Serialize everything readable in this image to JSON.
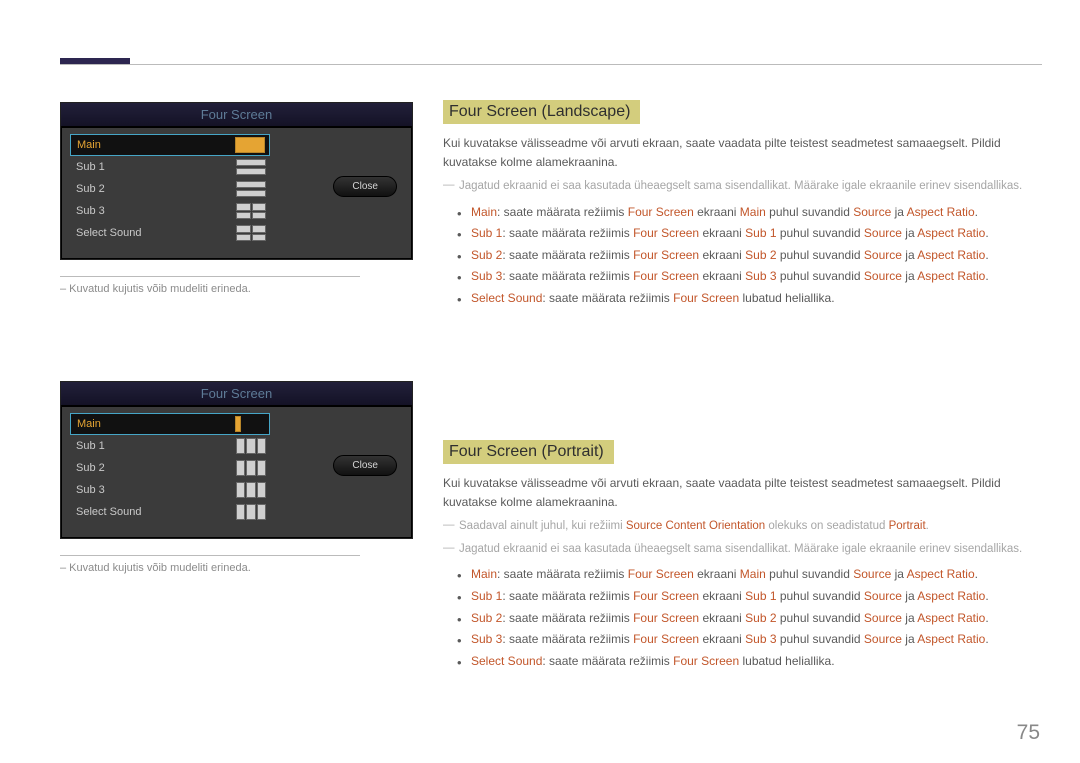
{
  "page_number": "75",
  "caption": "– Kuvatud kujutis võib mudeliti erineda.",
  "osd": {
    "title": "Four Screen",
    "items": [
      "Main",
      "Sub 1",
      "Sub 2",
      "Sub 3",
      "Select Sound"
    ],
    "close": "Close"
  },
  "sections": [
    {
      "heading": "Four Screen (Landscape)",
      "intro": "Kui kuvatakse välisseadme või arvuti ekraan, saate vaadata pilte teistest seadmetest samaaegselt. Pildid kuvatakse kolme alamekraanina.",
      "notes": [
        "Jagatud ekraanid ei saa kasutada üheaegselt sama sisendallikat. Määrake igale ekraanile erinev sisendallikas."
      ],
      "bullets": [
        {
          "kw": "Main",
          "t1": ": saate määrata režiimis ",
          "kw2": "Four Screen",
          "t2": " ekraani ",
          "kw3": "Main",
          "t3": " puhul suvandid ",
          "kw4": "Source",
          "t4": " ja ",
          "kw5": "Aspect Ratio",
          "t5": "."
        },
        {
          "kw": "Sub 1",
          "t1": ": saate määrata režiimis ",
          "kw2": "Four Screen",
          "t2": " ekraani ",
          "kw3": "Sub 1",
          "t3": " puhul suvandid ",
          "kw4": "Source",
          "t4": " ja ",
          "kw5": "Aspect Ratio",
          "t5": "."
        },
        {
          "kw": "Sub 2",
          "t1": ": saate määrata režiimis ",
          "kw2": "Four Screen",
          "t2": " ekraani ",
          "kw3": "Sub 2",
          "t3": " puhul suvandid ",
          "kw4": "Source",
          "t4": " ja ",
          "kw5": "Aspect Ratio",
          "t5": "."
        },
        {
          "kw": "Sub 3",
          "t1": ": saate määrata režiimis ",
          "kw2": "Four Screen",
          "t2": " ekraani ",
          "kw3": "Sub 3",
          "t3": " puhul suvandid ",
          "kw4": "Source",
          "t4": " ja ",
          "kw5": "Aspect Ratio",
          "t5": "."
        },
        {
          "kw": "Select Sound",
          "t1": ": saate määrata režiimis ",
          "kw2": "Four Screen",
          "t2": " lubatud heliallika.",
          "kw3": "",
          "t3": "",
          "kw4": "",
          "t4": "",
          "kw5": "",
          "t5": ""
        }
      ]
    },
    {
      "heading": "Four Screen (Portrait)",
      "intro": "Kui kuvatakse välisseadme või arvuti ekraan, saate vaadata pilte teistest seadmetest samaaegselt. Pildid kuvatakse kolme alamekraanina.",
      "notes": [
        {
          "pre": "Saadaval ainult juhul, kui režiimi ",
          "kw": "Source Content Orientation",
          "mid": " olekuks on seadistatud ",
          "kw2": "Portrait",
          "post": "."
        },
        "Jagatud ekraanid ei saa kasutada üheaegselt sama sisendallikat. Määrake igale ekraanile erinev sisendallikas."
      ],
      "bullets": [
        {
          "kw": "Main",
          "t1": ": saate määrata režiimis ",
          "kw2": "Four Screen",
          "t2": " ekraani ",
          "kw3": "Main",
          "t3": " puhul suvandid ",
          "kw4": "Source",
          "t4": " ja ",
          "kw5": "Aspect Ratio",
          "t5": "."
        },
        {
          "kw": "Sub 1",
          "t1": ": saate määrata režiimis ",
          "kw2": "Four Screen",
          "t2": " ekraani ",
          "kw3": "Sub 1",
          "t3": " puhul suvandid ",
          "kw4": "Source",
          "t4": " ja ",
          "kw5": "Aspect Ratio",
          "t5": "."
        },
        {
          "kw": "Sub 2",
          "t1": ": saate määrata režiimis ",
          "kw2": "Four Screen",
          "t2": " ekraani ",
          "kw3": "Sub 2",
          "t3": " puhul suvandid ",
          "kw4": "Source",
          "t4": " ja ",
          "kw5": "Aspect Ratio",
          "t5": "."
        },
        {
          "kw": "Sub 3",
          "t1": ": saate määrata režiimis ",
          "kw2": "Four Screen",
          "t2": " ekraani ",
          "kw3": "Sub 3",
          "t3": " puhul suvandid ",
          "kw4": "Source",
          "t4": " ja ",
          "kw5": "Aspect Ratio",
          "t5": "."
        },
        {
          "kw": "Select Sound",
          "t1": ": saate määrata režiimis ",
          "kw2": "Four Screen",
          "t2": " lubatud heliallika.",
          "kw3": "",
          "t3": "",
          "kw4": "",
          "t4": "",
          "kw5": "",
          "t5": ""
        }
      ]
    }
  ]
}
